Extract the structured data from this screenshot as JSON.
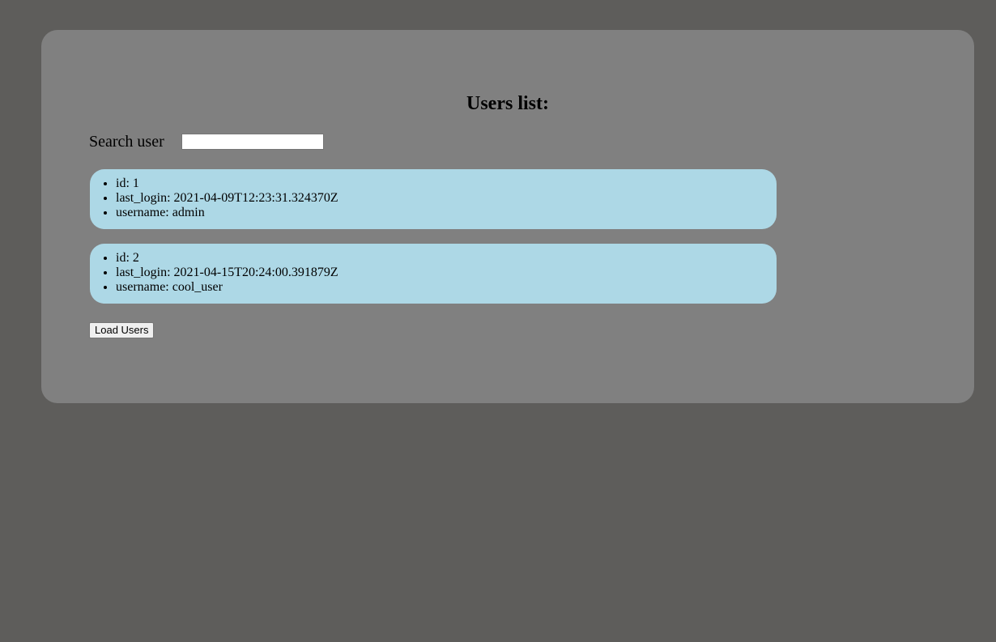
{
  "page": {
    "title": "Users list:"
  },
  "search": {
    "label": "Search user",
    "value": "",
    "placeholder": ""
  },
  "users": [
    {
      "id": "id: 1",
      "last_login": "last_login: 2021-04-09T12:23:31.324370Z",
      "username": "username: admin"
    },
    {
      "id": "id: 2",
      "last_login": "last_login: 2021-04-15T20:24:00.391879Z",
      "username": "username: cool_user"
    }
  ],
  "actions": {
    "load_users_label": "Load Users"
  },
  "colors": {
    "background": "#5e5d5b",
    "panel": "#808080",
    "card": "#add8e6"
  }
}
